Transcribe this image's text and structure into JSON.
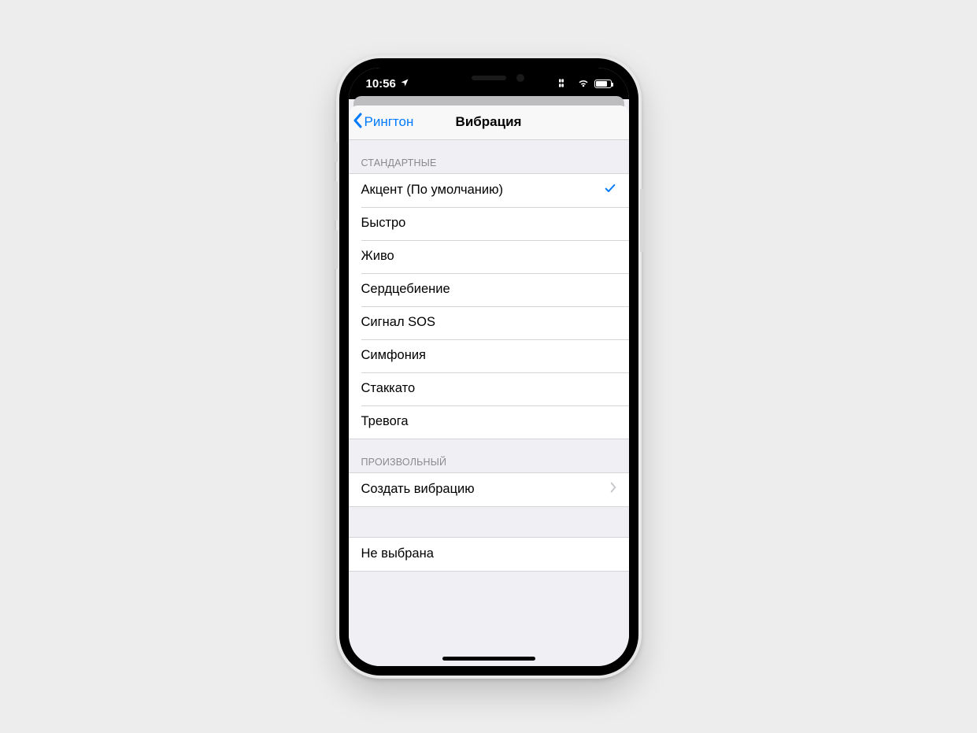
{
  "status": {
    "time": "10:56",
    "location_glyph": "➤"
  },
  "nav": {
    "back_label": "Рингтон",
    "title": "Вибрация"
  },
  "sections": {
    "standard": {
      "header": "СТАНДАРТНЫЕ",
      "items": [
        {
          "label": "Акцент (По умолчанию)",
          "selected": true
        },
        {
          "label": "Быстро",
          "selected": false
        },
        {
          "label": "Живо",
          "selected": false
        },
        {
          "label": "Сердцебиение",
          "selected": false
        },
        {
          "label": "Сигнал SOS",
          "selected": false
        },
        {
          "label": "Симфония",
          "selected": false
        },
        {
          "label": "Стаккато",
          "selected": false
        },
        {
          "label": "Тревога",
          "selected": false
        }
      ]
    },
    "custom": {
      "header": "ПРОИЗВОЛЬНЫЙ",
      "create_label": "Создать вибрацию"
    },
    "none": {
      "label": "Не выбрана"
    }
  }
}
